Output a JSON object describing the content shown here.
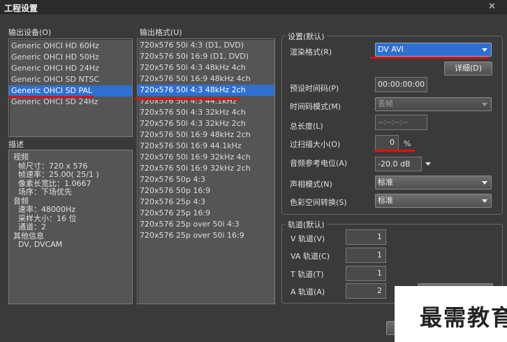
{
  "window": {
    "title": "工程设置",
    "close_glyph": "✕"
  },
  "output_device": {
    "label": "输出设备(O)",
    "items": [
      "Generic OHCI HD 60Hz",
      "Generic OHCI HD 50Hz",
      "Generic OHCI HD 24Hz",
      "Generic OHCI SD NTSC",
      "Generic OHCI SD PAL",
      "Generic OHCI SD 24Hz"
    ],
    "selected_index": 4
  },
  "description": {
    "label": "描述",
    "lines": [
      "视频",
      "  帧尺寸：720 x 576",
      "  帧速率：25.00( 25/1 )",
      "  像素长宽比：1.0667",
      "  场序：下场优先",
      "音频",
      "  速率：48000Hz",
      "  采样大小：16 位",
      "  通道：2",
      "其他信息",
      "  DV, DVCAM"
    ]
  },
  "output_format": {
    "label": "输出格式(U)",
    "items": [
      "720x576 50i 4:3 (D1, DVD)",
      "720x576 50i 16:9 (D1, DVD)",
      "720x576 50i 4:3 48kHz 4ch",
      "720x576 50i 16:9 48kHz 4ch",
      "720x576 50i 4:3 48kHz 2ch",
      "720x576 50i 4:3 44.1kHz",
      "720x576 50i 4:3 32kHz 4ch",
      "720x576 50i 4:3 32kHz 2ch",
      "720x576 50i 16:9 48kHz 2ch",
      "720x576 50i 16:9 44.1kHz",
      "720x576 50i 16:9 32kHz 4ch",
      "720x576 50i 16:9 32kHz 2ch",
      "720x576 50p 4:3",
      "720x576 50p 16:9",
      "720x576 25p 4:3",
      "720x576 25p 16:9",
      "720x576 25p over 50i 4:3",
      "720x576 25p over 50i 16:9"
    ],
    "selected_index": 4
  },
  "settings": {
    "group_label": "设置(默认)",
    "render_format": {
      "label": "渲染格式(R)",
      "value": "DV AVI"
    },
    "detail_button": "详细(D)",
    "preset_timecode": {
      "label": "预设时间码(P)",
      "value": "00:00:00:00"
    },
    "timecode_mode": {
      "label": "时间码模式(M)",
      "value": "丢帧"
    },
    "total_length": {
      "label": "总长度(L)",
      "value": "--:--:--:--"
    },
    "overscan": {
      "label": "过扫描大小(O)",
      "value": "0",
      "unit": "%"
    },
    "audio_ref_level": {
      "label": "音频参考电位(A)",
      "value": "-20.0 dB"
    },
    "pan_mode": {
      "label": "声相模式(N)",
      "value": "标准"
    },
    "color_space": {
      "label": "色彩空间转换(S)",
      "value": "标准"
    }
  },
  "tracks": {
    "group_label": "轨道(默认)",
    "v": {
      "label": "V 轨道(V)",
      "value": "1"
    },
    "va": {
      "label": "VA 轨道(C)",
      "value": "1"
    },
    "t": {
      "label": "T 轨道(T)",
      "value": "1"
    },
    "a": {
      "label": "A 轨道(A)",
      "value": "2"
    }
  },
  "watermark": "最需教育",
  "accent": {
    "selection": "#2f6fd0",
    "annotation": "#e01010"
  }
}
